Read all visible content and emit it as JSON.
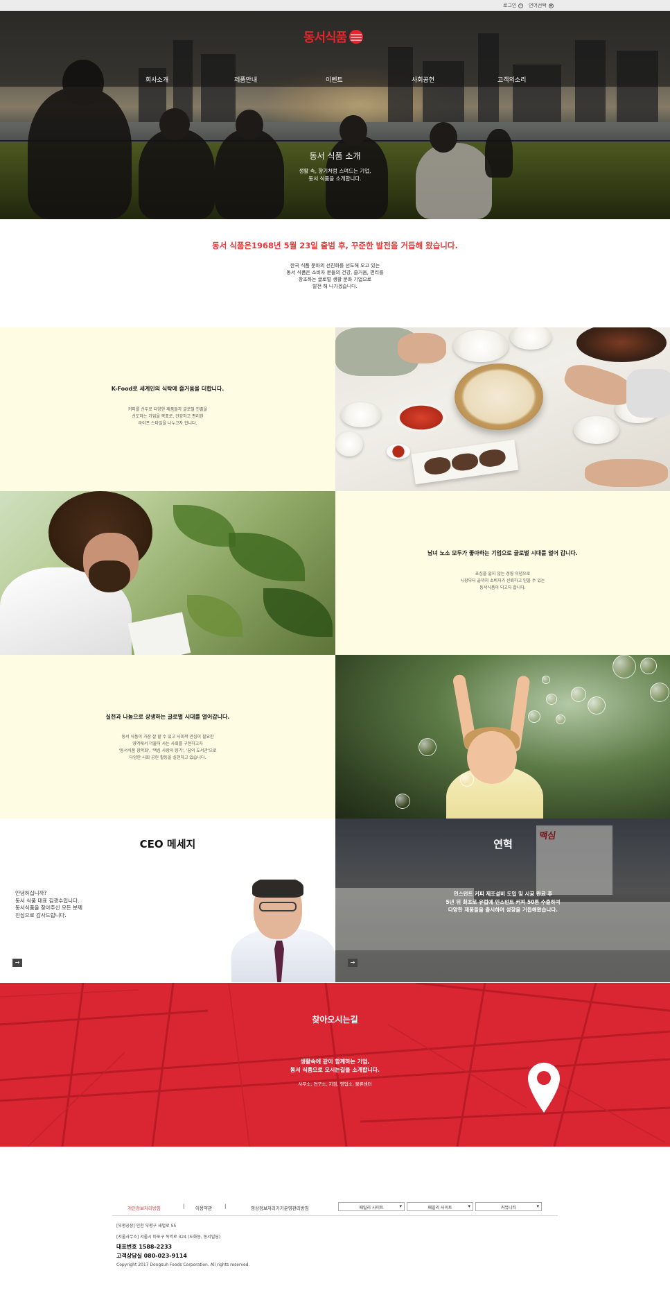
{
  "utility": {
    "login": "로그인",
    "language": "언어선택"
  },
  "header": {
    "logo_text": "동서식품",
    "nav": [
      "회사소개",
      "제품안내",
      "이벤트",
      "사회공헌",
      "고객의소리"
    ]
  },
  "hero": {
    "title": "동서 식품 소개",
    "desc_1": "생활 속, 향기처럼 스며드는 기업,",
    "desc_2": "동서 식품을 소개합니다."
  },
  "intro": {
    "headline": "동서 식품은1968년 5월 23일 출범 후, 꾸준한 발전을 거듭해 왔습니다.",
    "lines": [
      "한국 식품 문화의 선진화를 선도해 오고 있는",
      "동서 식품은 소비자 분들의 건강, 즐거움, 편리를",
      "창조하는 글로벌 생활 문화 기업으로",
      "발전 해 나가겠습니다."
    ]
  },
  "features": [
    {
      "title": "K-Food로 세계인의 식탁에 즐거움을 더합니다.",
      "lines": [
        "커피를 선두로 다양한 제품들과 글로벌 진출을",
        "선도하는 기업을 목표로, 건강하고 편리한",
        "라이프 스타일을 나누고자 합니다."
      ]
    },
    {
      "title": "남녀 노소 모두가 좋아하는 기업으로 글로벌 시대를 열어 갑니다.",
      "lines": [
        "초심을 잃지 않는 경영 이념으로",
        "시장부터 골까지 소비자가 신뢰하고 믿을 수 있는",
        "동서식품이 되고자 합니다."
      ]
    },
    {
      "title": "실천과 나눔으로 상생하는 글로벌 시대를 열어갑니다.",
      "lines": [
        "동서 식품이 가장 잘 할 수 있고 사회적 관심이 필요한",
        "영역에서 더불어 사는 사회를 구현하고자",
        "'동서식품 장학회', '맥심 사랑의 향기', '꿈의 도서관'으로",
        "다양한 사회 공헌 활동을 실천하고 있습니다."
      ]
    }
  ],
  "ceo": {
    "title": "CEO 메세지",
    "lines": [
      "안녕하십니까?",
      "동서 식품 대표 김광수입니다.",
      "동서식품을 찾아주신 모든 분께",
      "진심으로 감사드립니다."
    ],
    "arrow": "→"
  },
  "history": {
    "title": "연혁",
    "sign": "맥심",
    "lines": [
      "인스턴트 커피 제조설비 도입 및 시공 완료 후",
      "5년 뒤 최초로 유럽에 인스턴트 커피 50톤 수출하여",
      "다양한 제품들을 출시하며 성장을 거듭해왔습니다."
    ],
    "arrow": "→"
  },
  "location": {
    "title": "찾아오시는길",
    "lines": [
      "생활속에 같이 함께하는 기업,",
      "동서 식품으로 오시는길을 소개합니다."
    ],
    "sub": "사무소, 연구소, 지점, 영업소, 물류센터"
  },
  "footer": {
    "links": [
      "개인정보처리방침",
      "이용약관",
      "영상정보처리기기운영관리방침"
    ],
    "selects": [
      "패밀리 사이트",
      "패밀리 사이트",
      "커뮤니티"
    ],
    "address_1": "[부평공장] 인천 부평구 새벌로 55",
    "address_2": "[서울사무소] 서울시 마포구 독막로 324 (도화동, 동서빌딩)",
    "rep": "대표번호 1588-2233",
    "cs": "고객상담실 080-023-9114",
    "copyright": "Copyright 2017 Dongsuh Foods Corporation. All rights reserved."
  },
  "colors": {
    "accent_red": "#e2272f",
    "location_bg": "#da2533",
    "cream_tile": "#fefde4"
  }
}
